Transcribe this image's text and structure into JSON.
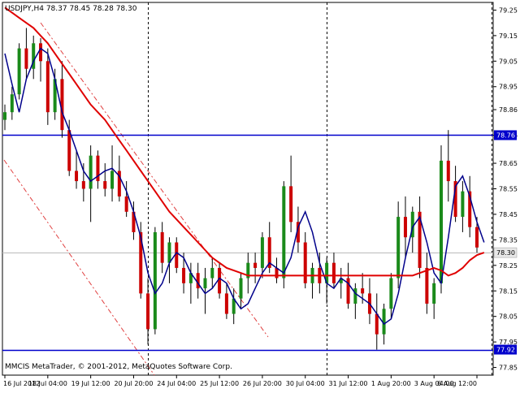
{
  "window": {
    "symbol_header": "USDJPY,H4  78.37 78.45 78.28 78.30",
    "copyright": "MMCIS MetaTrader, © 2001-2012, MetaQuotes Software Corp."
  },
  "colors": {
    "background": "#ffffff",
    "frame": "#000000",
    "bull_candle": "#1a8a1a",
    "bear_candle": "#cc0000",
    "wick": "#000000",
    "ma_fast": "#00008b",
    "ma_slow": "#e00000",
    "hline": "#0000cc",
    "hline_label_bg": "#0000cc",
    "hline_label_text": "#ffffff",
    "price_label_bg": "#e8e8e8",
    "channel": "#e04040",
    "vgrid": "#000000"
  },
  "chart_data": {
    "type": "candlestick",
    "symbol": "USDJPY",
    "timeframe": "H4",
    "ohlc_header": {
      "open": 78.37,
      "high": 78.45,
      "low": 78.28,
      "close": 78.3
    },
    "y_range": [
      77.82,
      79.28
    ],
    "y_ticks": [
      "79.25",
      "79.15",
      "79.05",
      "78.95",
      "78.86",
      "78.76",
      "78.65",
      "78.55",
      "78.45",
      "78.35",
      "78.25",
      "78.15",
      "78.05",
      "77.95",
      "77.85"
    ],
    "x_labels": [
      "16 Jul 2012",
      "18 Jul 04:00",
      "19 Jul 12:00",
      "20 Jul 20:00",
      "24 Jul 04:00",
      "25 Jul 12:00",
      "26 Jul 20:00",
      "30 Jul 04:00",
      "31 Jul 12:00",
      "1 Aug 20:00",
      "3 Aug 04:00",
      "6 Aug 12:00"
    ],
    "horizontal_levels": [
      {
        "value": 78.76,
        "label": "78.76"
      },
      {
        "value": 77.92,
        "label": "77.92"
      }
    ],
    "current_price": {
      "value": 78.3,
      "label": "78.30"
    },
    "period_separators": [
      20,
      45,
      68
    ],
    "candles": [
      [
        78.82,
        78.88,
        78.78,
        78.85
      ],
      [
        78.85,
        78.95,
        78.82,
        78.92
      ],
      [
        78.92,
        79.12,
        78.9,
        79.1
      ],
      [
        79.1,
        79.18,
        78.98,
        79.02
      ],
      [
        79.02,
        79.15,
        78.98,
        79.12
      ],
      [
        79.12,
        79.14,
        78.97,
        79.05
      ],
      [
        79.05,
        79.1,
        78.8,
        78.85
      ],
      [
        78.85,
        79.02,
        78.82,
        78.98
      ],
      [
        78.98,
        79.05,
        78.75,
        78.78
      ],
      [
        78.78,
        78.82,
        78.6,
        78.62
      ],
      [
        78.62,
        78.7,
        78.55,
        78.58
      ],
      [
        78.58,
        78.65,
        78.5,
        78.55
      ],
      [
        78.55,
        78.72,
        78.42,
        78.68
      ],
      [
        78.68,
        78.7,
        78.55,
        78.58
      ],
      [
        78.58,
        78.65,
        78.52,
        78.55
      ],
      [
        78.55,
        78.72,
        78.5,
        78.62
      ],
      [
        78.62,
        78.68,
        78.5,
        78.52
      ],
      [
        78.52,
        78.58,
        78.44,
        78.46
      ],
      [
        78.46,
        78.5,
        78.35,
        78.38
      ],
      [
        78.38,
        78.42,
        78.12,
        78.14
      ],
      [
        78.14,
        78.2,
        77.94,
        78.0
      ],
      [
        78.0,
        78.4,
        77.98,
        78.38
      ],
      [
        78.38,
        78.42,
        78.22,
        78.26
      ],
      [
        78.26,
        78.36,
        78.18,
        78.34
      ],
      [
        78.34,
        78.36,
        78.22,
        78.24
      ],
      [
        78.24,
        78.3,
        78.14,
        78.18
      ],
      [
        78.18,
        78.26,
        78.1,
        78.22
      ],
      [
        78.22,
        78.26,
        78.12,
        78.16
      ],
      [
        78.16,
        78.24,
        78.06,
        78.2
      ],
      [
        78.2,
        78.28,
        78.16,
        78.24
      ],
      [
        78.24,
        78.26,
        78.12,
        78.14
      ],
      [
        78.14,
        78.18,
        78.04,
        78.06
      ],
      [
        78.06,
        78.16,
        78.02,
        78.12
      ],
      [
        78.12,
        78.22,
        78.08,
        78.2
      ],
      [
        78.2,
        78.3,
        78.14,
        78.26
      ],
      [
        78.26,
        78.3,
        78.18,
        78.24
      ],
      [
        78.24,
        78.38,
        78.2,
        78.36
      ],
      [
        78.36,
        78.42,
        78.22,
        78.24
      ],
      [
        78.24,
        78.28,
        78.18,
        78.2
      ],
      [
        78.2,
        78.58,
        78.16,
        78.56
      ],
      [
        78.56,
        78.68,
        78.38,
        78.42
      ],
      [
        78.42,
        78.48,
        78.3,
        78.34
      ],
      [
        78.34,
        78.38,
        78.16,
        78.18
      ],
      [
        78.18,
        78.26,
        78.12,
        78.24
      ],
      [
        78.24,
        78.3,
        78.14,
        78.18
      ],
      [
        78.18,
        78.28,
        78.1,
        78.26
      ],
      [
        78.26,
        78.3,
        78.16,
        78.18
      ],
      [
        78.18,
        78.24,
        78.12,
        78.2
      ],
      [
        78.2,
        78.26,
        78.08,
        78.1
      ],
      [
        78.1,
        78.18,
        78.04,
        78.16
      ],
      [
        78.16,
        78.22,
        78.1,
        78.14
      ],
      [
        78.14,
        78.2,
        78.02,
        78.06
      ],
      [
        78.06,
        78.14,
        77.92,
        77.98
      ],
      [
        77.98,
        78.1,
        77.94,
        78.08
      ],
      [
        78.08,
        78.22,
        78.04,
        78.2
      ],
      [
        78.2,
        78.5,
        78.16,
        78.44
      ],
      [
        78.44,
        78.52,
        78.28,
        78.36
      ],
      [
        78.36,
        78.48,
        78.3,
        78.46
      ],
      [
        78.46,
        78.52,
        78.2,
        78.24
      ],
      [
        78.24,
        78.3,
        78.06,
        78.1
      ],
      [
        78.1,
        78.2,
        78.04,
        78.18
      ],
      [
        78.18,
        78.72,
        78.14,
        78.66
      ],
      [
        78.66,
        78.78,
        78.5,
        78.58
      ],
      [
        78.58,
        78.64,
        78.42,
        78.44
      ],
      [
        78.44,
        78.58,
        78.38,
        78.54
      ],
      [
        78.54,
        78.6,
        78.36,
        78.4
      ],
      [
        78.4,
        78.44,
        78.3,
        78.32
      ]
    ],
    "series": [
      {
        "name": "MA fast",
        "color": "#00008b",
        "values": [
          79.08,
          78.96,
          78.85,
          78.98,
          79.05,
          79.1,
          79.08,
          78.98,
          78.85,
          78.78,
          78.7,
          78.62,
          78.58,
          78.6,
          78.62,
          78.63,
          78.6,
          78.54,
          78.46,
          78.36,
          78.22,
          78.14,
          78.18,
          78.26,
          78.3,
          78.28,
          78.22,
          78.18,
          78.14,
          78.16,
          78.2,
          78.18,
          78.12,
          78.08,
          78.1,
          78.16,
          78.22,
          78.26,
          78.24,
          78.22,
          78.28,
          78.4,
          78.46,
          78.38,
          78.26,
          78.18,
          78.16,
          78.2,
          78.18,
          78.14,
          78.12,
          78.1,
          78.06,
          78.02,
          78.04,
          78.14,
          78.28,
          78.4,
          78.44,
          78.34,
          78.22,
          78.18,
          78.36,
          78.56,
          78.6,
          78.52,
          78.42,
          78.34
        ]
      },
      {
        "name": "MA slow",
        "color": "#e00000",
        "values": [
          79.26,
          79.24,
          79.22,
          79.2,
          79.18,
          79.15,
          79.12,
          79.08,
          79.04,
          79.0,
          78.96,
          78.92,
          78.88,
          78.85,
          78.82,
          78.78,
          78.74,
          78.7,
          78.66,
          78.62,
          78.58,
          78.54,
          78.5,
          78.46,
          78.43,
          78.4,
          78.37,
          78.34,
          78.31,
          78.28,
          78.26,
          78.24,
          78.23,
          78.22,
          78.21,
          78.21,
          78.21,
          78.21,
          78.21,
          78.21,
          78.21,
          78.21,
          78.21,
          78.21,
          78.21,
          78.21,
          78.21,
          78.21,
          78.21,
          78.21,
          78.21,
          78.21,
          78.21,
          78.21,
          78.21,
          78.21,
          78.21,
          78.21,
          78.22,
          78.23,
          78.24,
          78.23,
          78.21,
          78.22,
          78.24,
          78.27,
          78.29,
          78.3
        ]
      }
    ]
  }
}
